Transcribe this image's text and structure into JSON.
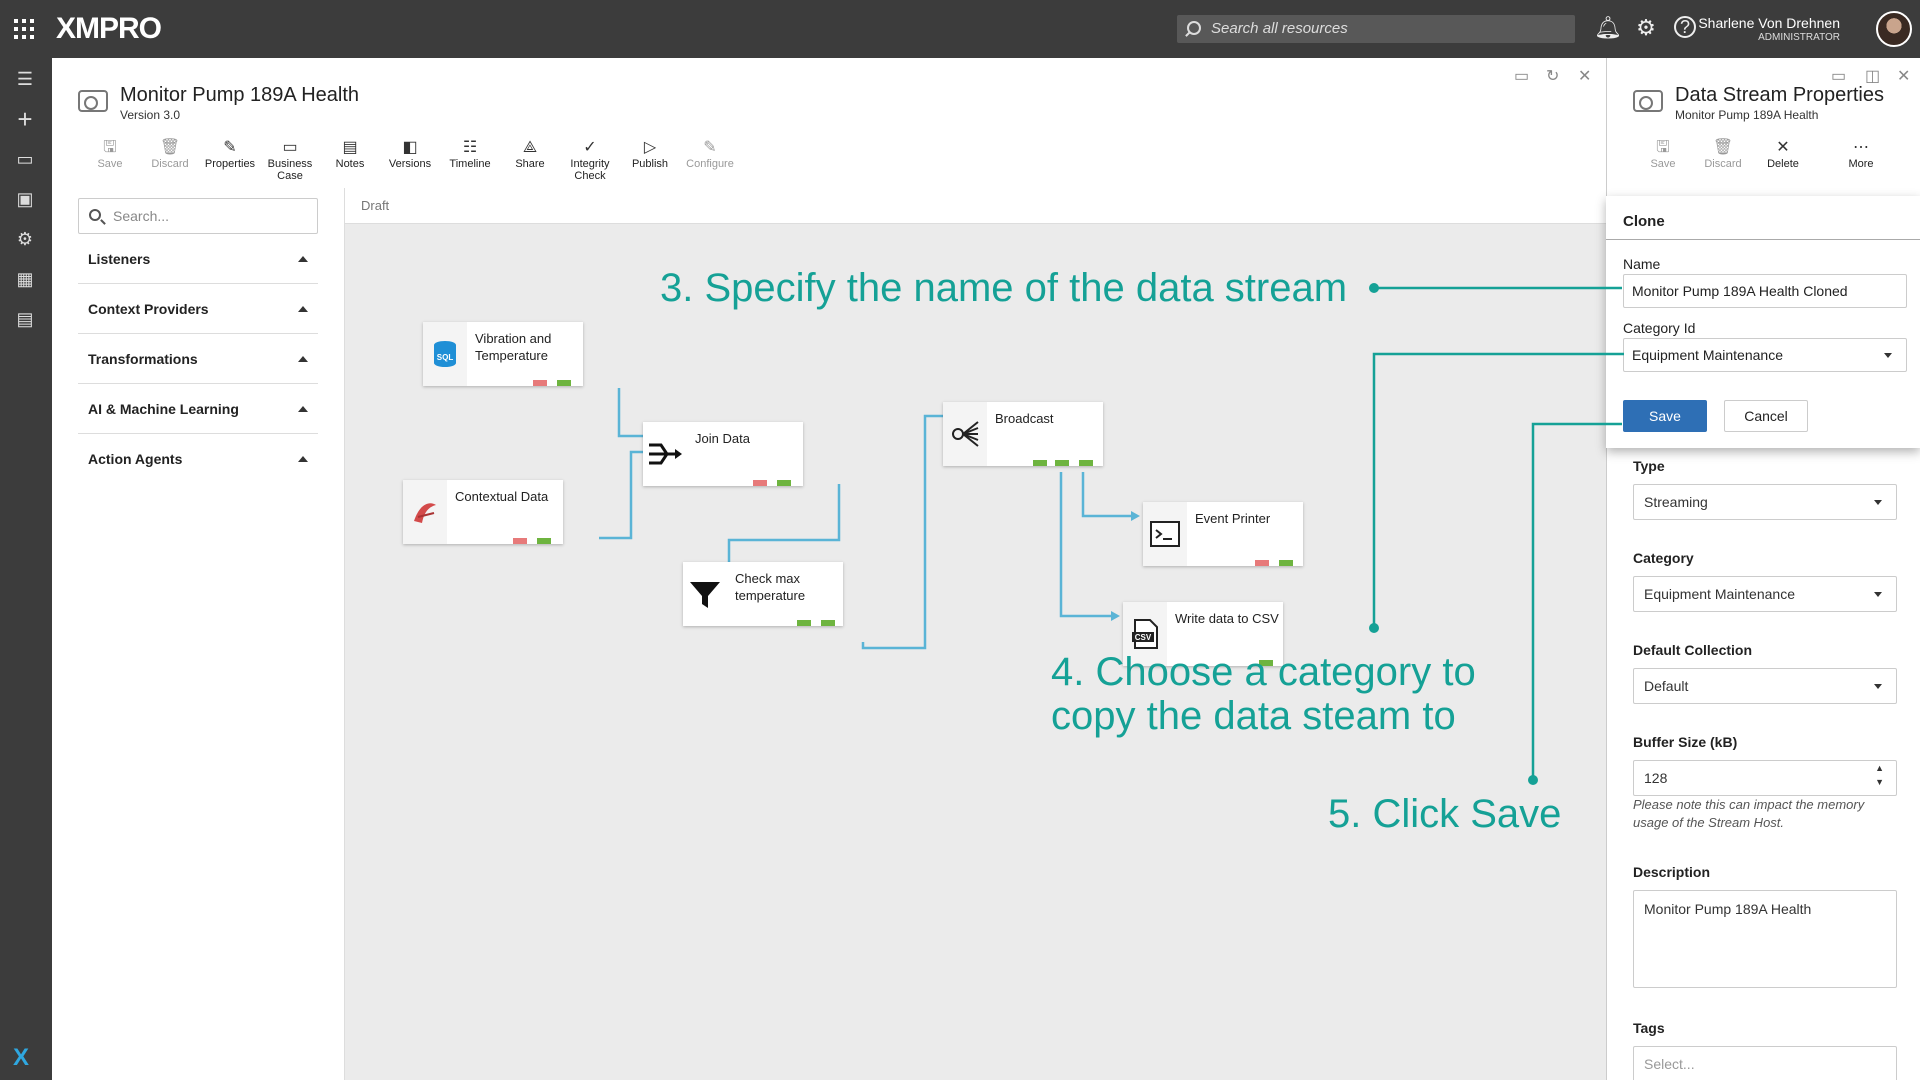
{
  "topbar": {
    "logo": "XMPRO",
    "search_placeholder": "Search all resources",
    "user_name": "Sharlene Von Drehnen",
    "user_role": "ADMINISTRATOR"
  },
  "app": {
    "title": "Monitor Pump 189A Health",
    "version": "Version 3.0",
    "toolbar": [
      {
        "label": "Save",
        "icon": "save-icon",
        "glyph": "🖫",
        "enabled": false
      },
      {
        "label": "Discard",
        "icon": "trash-icon",
        "glyph": "🗑",
        "enabled": false
      },
      {
        "label": "Properties",
        "icon": "pencil-icon",
        "glyph": "✎",
        "enabled": true
      },
      {
        "label": "Business Case",
        "icon": "briefcase-icon",
        "glyph": "▭",
        "enabled": true
      },
      {
        "label": "Notes",
        "icon": "notes-icon",
        "glyph": "▤",
        "enabled": true
      },
      {
        "label": "Versions",
        "icon": "versions-icon",
        "glyph": "◧",
        "enabled": true
      },
      {
        "label": "Timeline",
        "icon": "timeline-icon",
        "glyph": "☷",
        "enabled": true
      },
      {
        "label": "Share",
        "icon": "share-icon",
        "glyph": "⟁",
        "enabled": true
      },
      {
        "label": "Integrity Check",
        "icon": "check-circle-icon",
        "glyph": "✓",
        "enabled": true
      },
      {
        "label": "Publish",
        "icon": "play-icon",
        "glyph": "▷",
        "enabled": true
      },
      {
        "label": "Configure",
        "icon": "pencil-icon",
        "glyph": "✎",
        "enabled": false
      }
    ]
  },
  "palette": {
    "search_placeholder": "Search...",
    "groups": [
      "Listeners",
      "Context Providers",
      "Transformations",
      "AI & Machine Learning",
      "Action Agents"
    ]
  },
  "canvas": {
    "status": "Draft",
    "nodes": {
      "vibration": "Vibration and Temperature",
      "contextual": "Contextual Data",
      "join": "Join Data",
      "check": "Check max temperature",
      "broadcast": "Broadcast",
      "printer": "Event Printer",
      "csv": "Write data to CSV"
    },
    "link_color": "#5ab4d6",
    "port_green": "#6eb43f",
    "port_red": "#e77a7a"
  },
  "props": {
    "title": "Data Stream Properties",
    "subtitle": "Monitor Pump 189A Health",
    "toolbar": [
      {
        "label": "Save",
        "icon": "save-icon",
        "glyph": "🖫",
        "enabled": false
      },
      {
        "label": "Discard",
        "icon": "trash-icon",
        "glyph": "🗑",
        "enabled": false
      },
      {
        "label": "Delete",
        "icon": "close-icon",
        "glyph": "✕",
        "enabled": true
      },
      {
        "label": "More",
        "icon": "more-icon",
        "glyph": "⋯",
        "enabled": true
      }
    ],
    "type_label": "Type",
    "type_value": "Streaming",
    "category_label": "Category",
    "category_value": "Equipment Maintenance",
    "collection_label": "Default Collection",
    "collection_value": "Default",
    "buffer_label": "Buffer Size (kB)",
    "buffer_value": "128",
    "buffer_note": "Please note this can impact the memory usage of the Stream Host.",
    "description_label": "Description",
    "description_value": "Monitor Pump 189A Health",
    "tags_label": "Tags",
    "tags_placeholder": "Select..."
  },
  "clone": {
    "heading": "Clone",
    "name_label": "Name",
    "name_value": "Monitor Pump 189A Health Cloned",
    "category_label": "Category Id",
    "category_value": "Equipment Maintenance",
    "save_label": "Save",
    "cancel_label": "Cancel"
  },
  "annotations": {
    "color": "#15a196",
    "step3": "3. Specify the name of the data stream",
    "step4_line1": "4. Choose a category to",
    "step4_line2": "copy the data steam to",
    "step5": "5. Click Save"
  }
}
